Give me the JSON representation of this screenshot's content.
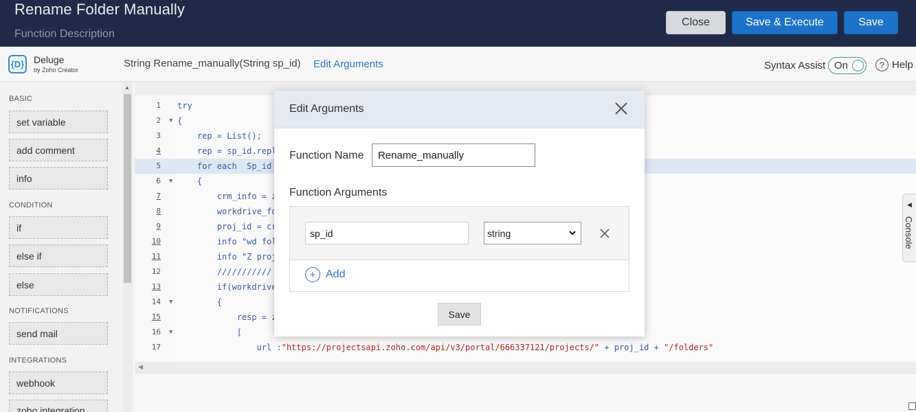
{
  "header": {
    "title": "Rename Folder Manually",
    "description": "Function Description",
    "buttons": {
      "close": "Close",
      "save_execute": "Save & Execute",
      "save": "Save"
    }
  },
  "toolbar": {
    "logo_name": "Deluge",
    "logo_sub": "by Zoho Creator",
    "logo_glyph": "{D}",
    "signature": "String  Rename_manually(String sp_id)",
    "edit_arguments": "Edit Arguments",
    "syntax_assist": "Syntax Assist",
    "toggle_state": "On",
    "help_glyph": "?",
    "help": "Help"
  },
  "sidebar": {
    "sections": [
      {
        "heading": "BASIC",
        "items": [
          "set variable",
          "add comment",
          "info"
        ]
      },
      {
        "heading": "CONDITION",
        "items": [
          "if",
          "else if",
          "else"
        ]
      },
      {
        "heading": "NOTIFICATIONS",
        "items": [
          "send mail"
        ]
      },
      {
        "heading": "INTEGRATIONS",
        "items": [
          "webhook",
          "zoho integration"
        ]
      }
    ]
  },
  "editor": {
    "lines": [
      {
        "n": "1",
        "text": "try"
      },
      {
        "n": "2",
        "text": "{"
      },
      {
        "n": "3",
        "text": "    rep = List();"
      },
      {
        "n": "4",
        "text": "    rep = sp_id.repl"
      },
      {
        "n": "5",
        "text": "    for each  Sp_id"
      },
      {
        "n": "6",
        "text": "    {"
      },
      {
        "n": "7",
        "text": "        crm_info = z"
      },
      {
        "n": "8",
        "text": "        workdrive_fo"
      },
      {
        "n": "9",
        "text": "        proj_id = cr"
      },
      {
        "n": "10",
        "text": "        info \"wd fol"
      },
      {
        "n": "11",
        "text": "        info \"Z proj"
      },
      {
        "n": "12",
        "text": "        ///////////                                                                   //"
      },
      {
        "n": "13",
        "text": "        if(workdrive"
      },
      {
        "n": "14",
        "text": "        {"
      },
      {
        "n": "15",
        "text": "            resp = z"
      },
      {
        "n": "16",
        "text": "            ["
      },
      {
        "n": "17",
        "text_pre": "                url :",
        "text_str": "\"https://projectsapi.zoho.com/api/v3/portal/666337121/projects/\"",
        "text_post": " + proj_id + ",
        "text_str2": "\"/folders\""
      }
    ]
  },
  "console_label": "Console",
  "modal": {
    "title": "Edit Arguments",
    "function_name_label": "Function Name",
    "function_name_value": "Rename_manually",
    "function_arguments_label": "Function Arguments",
    "argument": {
      "name": "sp_id",
      "type": "string"
    },
    "add_glyph": "+",
    "add_label": "Add",
    "save": "Save"
  },
  "colors": {
    "header_bg": "#1e2a47",
    "accent": "#1d73c9",
    "link": "#2a78c5"
  }
}
